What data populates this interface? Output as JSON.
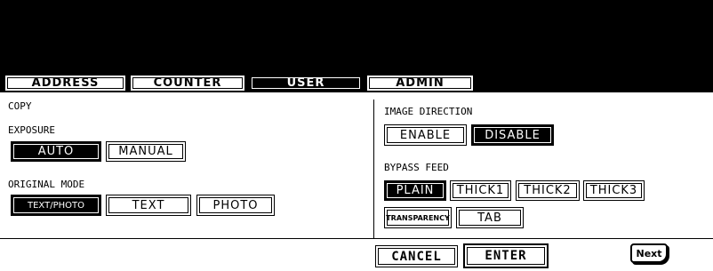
{
  "tabs": [
    {
      "label": "ADDRESS",
      "active": false
    },
    {
      "label": "COUNTER",
      "active": false
    },
    {
      "label": "USER",
      "active": true
    },
    {
      "label": "ADMIN",
      "active": false
    }
  ],
  "left": {
    "section_title": "COPY",
    "exposure": {
      "label": "EXPOSURE",
      "options": [
        "AUTO",
        "MANUAL"
      ],
      "selected": "AUTO"
    },
    "original_mode": {
      "label": "ORIGINAL MODE",
      "options": [
        "TEXT/PHOTO",
        "TEXT",
        "PHOTO"
      ],
      "selected": "TEXT/PHOTO"
    }
  },
  "right": {
    "image_direction": {
      "label": "IMAGE DIRECTION",
      "options": [
        "ENABLE",
        "DISABLE"
      ],
      "selected": "DISABLE"
    },
    "bypass_feed": {
      "label": "BYPASS FEED",
      "options": [
        "PLAIN",
        "THICK1",
        "THICK2",
        "THICK3",
        "TRANSPARENCY",
        "TAB"
      ],
      "selected": "PLAIN"
    }
  },
  "footer": {
    "cancel": "CANCEL",
    "enter": "ENTER",
    "next": "Next"
  }
}
